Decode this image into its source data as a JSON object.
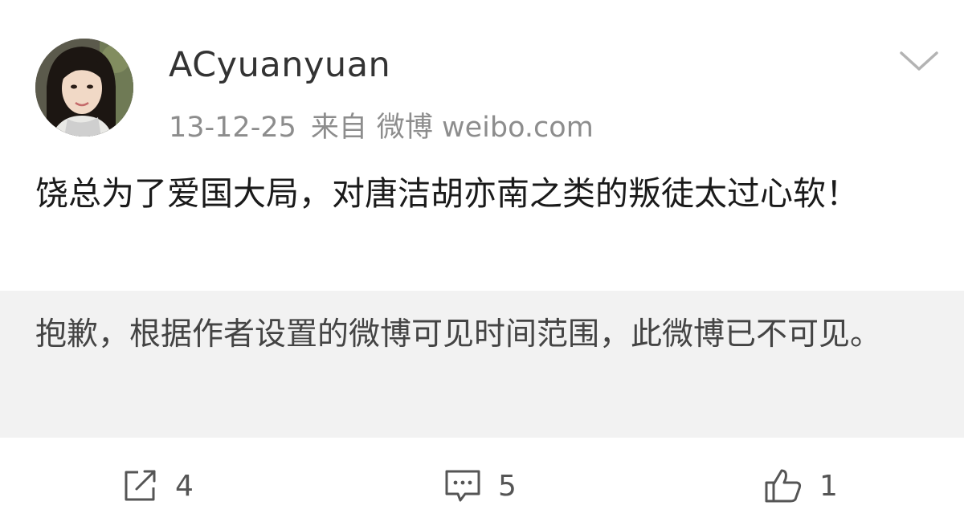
{
  "post": {
    "username": "ACyuanyuan",
    "date": "13-12-25",
    "source_prefix": "来自",
    "source": "微博 weibo.com",
    "text": "饶总为了爱国大局，对唐洁胡亦南之类的叛徒太过心软！",
    "notice": "抱歉，根据作者设置的微博可见时间范围，此微博已不可见。"
  },
  "actions": {
    "repost_count": "4",
    "comment_count": "5",
    "like_count": "1"
  },
  "icons": {
    "menu": "chevron-down-icon",
    "repost": "repost-icon",
    "comment": "comment-icon",
    "like": "thumbs-up-icon"
  },
  "colors": {
    "text": "#1a1a1a",
    "muted": "#8d8d8d",
    "notice_bg": "#f2f2f2"
  }
}
